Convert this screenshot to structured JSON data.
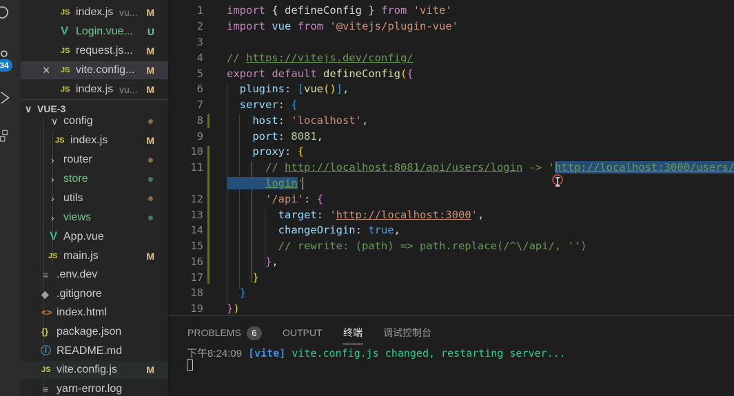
{
  "activity_bar": {
    "scm_badge": "34",
    "icons": [
      "search-icon",
      "source-control-icon",
      "run-debug-icon",
      "extensions-icon"
    ]
  },
  "explorer": {
    "open_editors": [
      {
        "icon": "JS",
        "name": "index.js",
        "hint": "vu...",
        "status": "M"
      },
      {
        "icon": "V",
        "name": "Login.vue...",
        "hint": "",
        "status": "U"
      },
      {
        "icon": "JS",
        "name": "request.js...",
        "hint": "",
        "status": "M"
      },
      {
        "icon": "JS",
        "name": "vite.config...",
        "hint": "",
        "status": "M",
        "close": "×"
      },
      {
        "icon": "JS",
        "name": "index.js",
        "hint": "vu...",
        "status": "M"
      }
    ],
    "project_title": "VUE-3",
    "tree": [
      {
        "kind": "folder-open",
        "name": "config"
      },
      {
        "kind": "js",
        "icon": "JS",
        "name": "index.js",
        "status": "M"
      },
      {
        "kind": "folder",
        "name": "router"
      },
      {
        "kind": "folder",
        "name": "store"
      },
      {
        "kind": "folder",
        "name": "utils"
      },
      {
        "kind": "folder",
        "name": "views"
      },
      {
        "kind": "vue",
        "icon": "V",
        "name": "App.vue"
      },
      {
        "kind": "js",
        "icon": "JS",
        "name": "main.js",
        "status": "M"
      },
      {
        "kind": "env",
        "icon": "≡",
        "name": ".env.dev"
      },
      {
        "kind": "git",
        "icon": "◆",
        "name": ".gitignore"
      },
      {
        "kind": "html",
        "icon": "<>",
        "name": "index.html"
      },
      {
        "kind": "json",
        "icon": "{}",
        "name": "package.json"
      },
      {
        "kind": "info",
        "icon": "ⓘ",
        "name": "README.md"
      },
      {
        "kind": "js",
        "icon": "JS",
        "name": "vite.config.js",
        "status": "M"
      },
      {
        "kind": "log",
        "icon": "≡",
        "name": "yarn-error.log"
      }
    ]
  },
  "editor": {
    "line_numbers": [
      "1",
      "2",
      "3",
      "4",
      "5",
      "6",
      "7",
      "8",
      "9",
      "10",
      "11",
      "12",
      "13",
      "14",
      "15",
      "16",
      "17",
      "18",
      "19"
    ],
    "code": {
      "l1_import": "import",
      "l1_mid": "{ defineConfig }",
      "l1_from": "from",
      "l1_str": "'vite'",
      "l2_import": "import",
      "l2_vue": "vue",
      "l2_from": "from",
      "l2_str": "'@vitejs/plugin-vue'",
      "l4_comment": "// ",
      "l4_url": "https://vitejs.dev/config/",
      "l5_export": "export",
      "l5_default": "default",
      "l5_fn": "defineConfig",
      "l6_key": "plugins",
      "l6_fn": "vue",
      "l7_key": "server",
      "l8_key": "host",
      "l8_str": "'localhost'",
      "l9_key": "port",
      "l9_num": "8081",
      "l10_key": "proxy",
      "l11_comment": "// ",
      "l11_url1": "http://localhost:8081/api/users/login",
      "l11_arrow": " -> '",
      "l11_url2": "http://localhost:3000/users/",
      "l11b_url": "login",
      "l11b_end": "'",
      "l12_str": "'/api'",
      "l13_key": "target",
      "l13_q1": "'",
      "l13_url": "http://localhost:3000",
      "l13_q2": "'",
      "l14_key": "changeOrigin",
      "l14_val": "true",
      "l15_comment": "// rewrite: (path) => path.replace(/^\\/api/, '')"
    }
  },
  "panel": {
    "tabs": [
      {
        "label": "PROBLEMS",
        "badge": "6"
      },
      {
        "label": "OUTPUT"
      },
      {
        "label": "终端"
      },
      {
        "label": "调试控制台"
      }
    ],
    "terminal": {
      "time": "下午8:24:09",
      "tag": "[vite]",
      "message": "vite.config.js changed, restarting server..."
    }
  }
}
